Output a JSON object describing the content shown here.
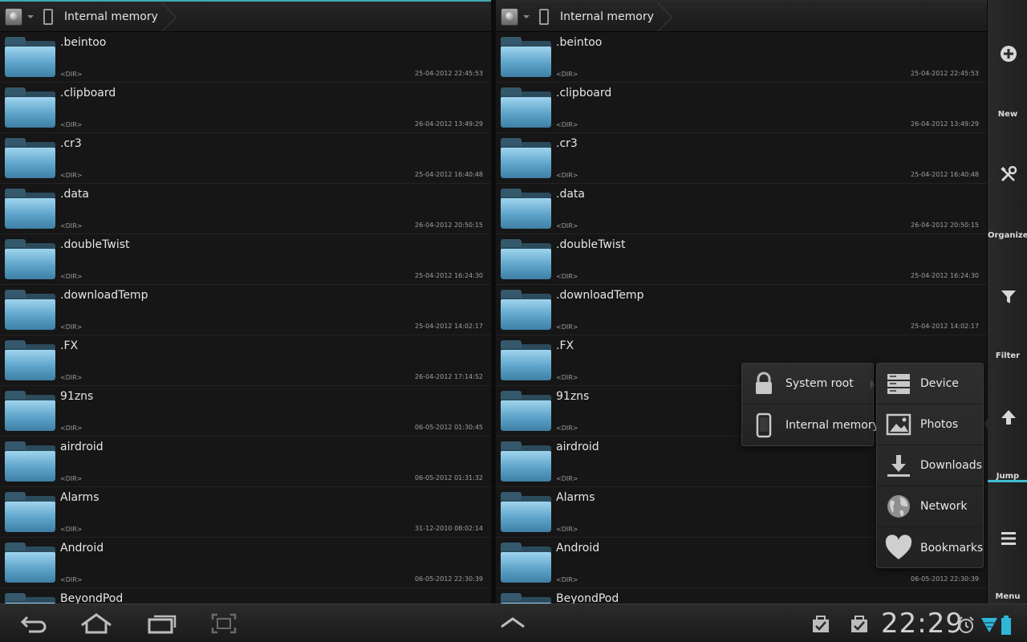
{
  "panes": [
    {
      "id": "left",
      "breadcrumb": {
        "location": "Internal memory"
      },
      "files": [
        {
          "name": ".beintoo",
          "kind": "<DIR>",
          "date": "25-04-2012 22:45:53"
        },
        {
          "name": ".clipboard",
          "kind": "<DIR>",
          "date": "26-04-2012 13:49:29"
        },
        {
          "name": ".cr3",
          "kind": "<DIR>",
          "date": "25-04-2012 16:40:48"
        },
        {
          "name": ".data",
          "kind": "<DIR>",
          "date": "26-04-2012 20:50:15"
        },
        {
          "name": ".doubleTwist",
          "kind": "<DIR>",
          "date": "25-04-2012 16:24:30"
        },
        {
          "name": ".downloadTemp",
          "kind": "<DIR>",
          "date": "25-04-2012 14:02:17"
        },
        {
          "name": ".FX",
          "kind": "<DIR>",
          "date": "26-04-2012 17:14:52"
        },
        {
          "name": "91zns",
          "kind": "<DIR>",
          "date": "06-05-2012 01:30:45"
        },
        {
          "name": "airdroid",
          "kind": "<DIR>",
          "date": "06-05-2012 01:31:32"
        },
        {
          "name": "Alarms",
          "kind": "<DIR>",
          "date": "31-12-2010 08:02:14"
        },
        {
          "name": "Android",
          "kind": "<DIR>",
          "date": "06-05-2012 22:30:39"
        },
        {
          "name": "BeyondPod",
          "kind": "",
          "date": ""
        }
      ]
    },
    {
      "id": "right",
      "breadcrumb": {
        "location": "Internal memory"
      },
      "files": [
        {
          "name": ".beintoo",
          "kind": "<DIR>",
          "date": "25-04-2012 22:45:53"
        },
        {
          "name": ".clipboard",
          "kind": "<DIR>",
          "date": "26-04-2012 13:49:29"
        },
        {
          "name": ".cr3",
          "kind": "<DIR>",
          "date": "25-04-2012 16:40:48"
        },
        {
          "name": ".data",
          "kind": "<DIR>",
          "date": "26-04-2012 20:50:15"
        },
        {
          "name": ".doubleTwist",
          "kind": "<DIR>",
          "date": "25-04-2012 16:24:30"
        },
        {
          "name": ".downloadTemp",
          "kind": "<DIR>",
          "date": "25-04-2012 14:02:17"
        },
        {
          "name": ".FX",
          "kind": "<DIR>",
          "date": ""
        },
        {
          "name": "91zns",
          "kind": "<DIR>",
          "date": ""
        },
        {
          "name": "airdroid",
          "kind": "<DIR>",
          "date": ""
        },
        {
          "name": "Alarms",
          "kind": "<DIR>",
          "date": ""
        },
        {
          "name": "Android",
          "kind": "<DIR>",
          "date": "06-05-2012 22:30:39"
        },
        {
          "name": "BeyondPod",
          "kind": "",
          "date": ""
        }
      ]
    }
  ],
  "sidebar": {
    "new_label": "New",
    "organize_label": "Organize",
    "filter_label": "Filter",
    "jump_label": "Jump",
    "menu_label": "Menu",
    "accent_color": "#3fbfd0"
  },
  "jump_popup": {
    "locations": [
      {
        "label": "System root",
        "icon": "lock-icon"
      },
      {
        "label": "Internal memory",
        "icon": "phone-icon"
      }
    ],
    "shortcuts": [
      {
        "label": "Device",
        "icon": "storage-icon"
      },
      {
        "label": "Photos",
        "icon": "photo-icon"
      },
      {
        "label": "Downloads",
        "icon": "download-icon"
      },
      {
        "label": "Network",
        "icon": "globe-icon"
      },
      {
        "label": "Bookmarks",
        "icon": "heart-icon"
      }
    ]
  },
  "statusbar": {
    "time": "22:29"
  }
}
